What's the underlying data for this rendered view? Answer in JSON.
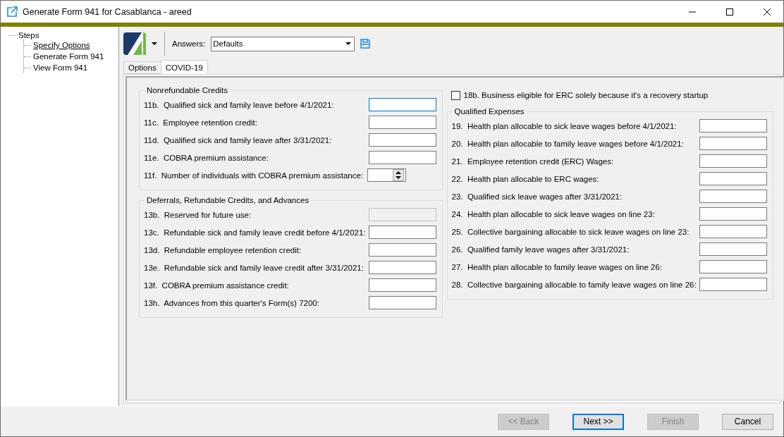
{
  "window": {
    "title": "Generate Form 941 for Casablanca - areed"
  },
  "sidebar": {
    "root": "Steps",
    "children": [
      {
        "label": "Specify Options",
        "selected": true
      },
      {
        "label": "Generate Form 941",
        "selected": false
      },
      {
        "label": "View Form 941",
        "selected": false
      }
    ]
  },
  "toolbar": {
    "answers_label": "Answers:",
    "answers_value": "Defaults"
  },
  "tabs": [
    {
      "label": "Options",
      "selected": false
    },
    {
      "label": "COVID-19",
      "selected": true
    }
  ],
  "left_groups": [
    {
      "title": "Nonrefundable Credits",
      "fields": [
        {
          "label": "11b.  Qualified sick and family leave before 4/1/2021:",
          "kind": "text",
          "focused": true,
          "disabled": false
        },
        {
          "label": "11c.  Employee retention credit:",
          "kind": "text",
          "focused": false,
          "disabled": false
        },
        {
          "label": "11d.  Qualified sick and family leave after 3/31/2021:",
          "kind": "text",
          "focused": false,
          "disabled": false
        },
        {
          "label": "11e.  COBRA premium assistance:",
          "kind": "text",
          "focused": false,
          "disabled": false
        },
        {
          "label": "11f.  Number of individuals with COBRA premium assistance:",
          "kind": "spin",
          "focused": false,
          "disabled": false
        }
      ]
    },
    {
      "title": "Deferrals, Refundable Credits, and Advances",
      "fields": [
        {
          "label": "13b.  Reserved for future use:",
          "kind": "text",
          "focused": false,
          "disabled": true
        },
        {
          "label": "13c.  Refundable sick and family leave credit before 4/1/2021:",
          "kind": "text",
          "focused": false,
          "disabled": false
        },
        {
          "label": "13d.  Refundable employee retention credit:",
          "kind": "text",
          "focused": false,
          "disabled": false
        },
        {
          "label": "13e.  Refundable sick and family leave credit after 3/31/2021:",
          "kind": "text",
          "focused": false,
          "disabled": false
        },
        {
          "label": "13f.  COBRA premium assistance credit:",
          "kind": "text",
          "focused": false,
          "disabled": false
        },
        {
          "label": "13h.  Advances from this quarter's Form(s) 7200:",
          "kind": "text",
          "focused": false,
          "disabled": false
        }
      ]
    }
  ],
  "checkbox": {
    "label": "18b. Business eligible for ERC solely because it's a recovery startup",
    "checked": false
  },
  "right_group": {
    "title": "Qualified Expenses",
    "fields": [
      {
        "label": "19.  Health plan allocable to sick leave wages before 4/1/2021:",
        "kind": "text",
        "focused": false,
        "disabled": false
      },
      {
        "label": "20.  Health plan allocable to family leave wages before 4/1/2021:",
        "kind": "text",
        "focused": false,
        "disabled": false
      },
      {
        "label": "21.  Employee retention credit (ERC) Wages:",
        "kind": "text",
        "focused": false,
        "disabled": false
      },
      {
        "label": "22.  Health plan allocable to ERC wages:",
        "kind": "text",
        "focused": false,
        "disabled": false
      },
      {
        "label": "23.  Qualified sick leave wages after 3/31/2021:",
        "kind": "text",
        "focused": false,
        "disabled": false
      },
      {
        "label": "24.  Health plan allocable to sick leave wages on line 23:",
        "kind": "text",
        "focused": false,
        "disabled": false
      },
      {
        "label": "25.  Collective bargaining allocable to sick leave wages on line 23:",
        "kind": "text",
        "focused": false,
        "disabled": false
      },
      {
        "label": "26.  Qualified family leave wages after 3/31/2021:",
        "kind": "text",
        "focused": false,
        "disabled": false
      },
      {
        "label": "27.  Health plan allocable to family leave wages on line 26:",
        "kind": "text",
        "focused": false,
        "disabled": false
      },
      {
        "label": "28.  Collective bargaining allocable to family leave wages on line 26:",
        "kind": "text",
        "focused": false,
        "disabled": false
      }
    ]
  },
  "buttons": [
    {
      "label": "<< Back",
      "disabled": true,
      "default": false
    },
    {
      "label": "Next >>",
      "disabled": false,
      "default": true
    },
    {
      "label": "Finish",
      "disabled": true,
      "default": false
    },
    {
      "label": "Cancel",
      "disabled": false,
      "default": false
    }
  ]
}
